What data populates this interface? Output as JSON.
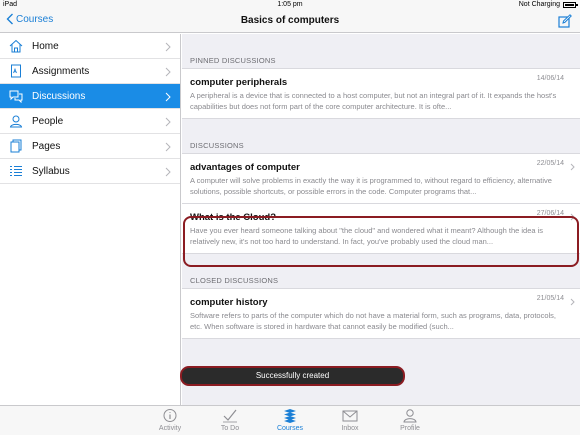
{
  "status_bar": {
    "device": "iPad",
    "time": "1:05 pm",
    "battery_status": "Not Charging"
  },
  "nav": {
    "back_label": "Courses",
    "title": "Basics of computers"
  },
  "sidebar": {
    "items": [
      {
        "label": "Home",
        "icon": "home-icon"
      },
      {
        "label": "Assignments",
        "icon": "assignments-icon"
      },
      {
        "label": "Discussions",
        "icon": "discussions-icon",
        "active": true
      },
      {
        "label": "People",
        "icon": "people-icon"
      },
      {
        "label": "Pages",
        "icon": "pages-icon"
      },
      {
        "label": "Syllabus",
        "icon": "syllabus-icon"
      }
    ]
  },
  "sections": {
    "pinned": {
      "header": "PINNED DISCUSSIONS",
      "items": [
        {
          "title": "computer peripherals",
          "date": "14/06/14",
          "excerpt": "A peripheral is a device that is connected to a host computer, but not an integral part of it. It expands the host's capabilities but does not form part of the core computer architecture. It is ofte..."
        }
      ]
    },
    "discussions": {
      "header": "DISCUSSIONS",
      "items": [
        {
          "title": "advantages of computer",
          "date": "22/05/14",
          "excerpt": "A computer will solve problems in exactly the way it is programmed to, without regard to efficiency, alternative solutions, possible shortcuts, or possible errors in the code. Computer programs that..."
        },
        {
          "title": "What is the Cloud?",
          "date": "27/06/14",
          "excerpt": "Have you ever heard someone talking about \"the cloud\" and wondered what it meant? Although the idea is relatively new, it's not too hard to understand. In fact, you've probably used the cloud man..."
        }
      ]
    },
    "closed": {
      "header": "CLOSED DISCUSSIONS",
      "items": [
        {
          "title": "computer history",
          "date": "21/05/14",
          "excerpt": "Software refers to parts of the computer which do not have a material form, such as programs, data, protocols, etc. When software is stored in hardware that cannot easily be modified (such..."
        }
      ]
    }
  },
  "toast": {
    "message": "Successfully created"
  },
  "tabbar": {
    "tabs": [
      {
        "label": "Activity",
        "icon": "activity-icon"
      },
      {
        "label": "To Do",
        "icon": "todo-icon"
      },
      {
        "label": "Courses",
        "icon": "courses-icon",
        "active": true
      },
      {
        "label": "Inbox",
        "icon": "inbox-icon"
      },
      {
        "label": "Profile",
        "icon": "profile-icon"
      }
    ]
  },
  "colors": {
    "accent": "#1a8ce6",
    "highlight_ring": "#8b1c22",
    "toast_bg": "#2b2b2b"
  }
}
